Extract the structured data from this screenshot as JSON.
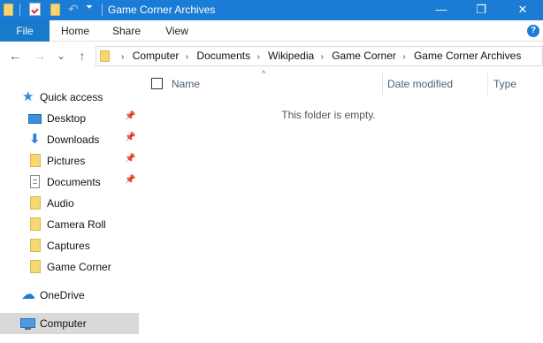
{
  "window": {
    "title": "Game Corner Archives",
    "controls": {
      "minimize": "—",
      "maximize": "❐",
      "close": "✕"
    }
  },
  "ribbon": {
    "tabs": [
      "File",
      "Home",
      "Share",
      "View"
    ],
    "help": "?"
  },
  "navigation": {
    "back": "←",
    "forward": "→",
    "recent": "⌄",
    "up": "↑"
  },
  "address": {
    "crumbs": [
      "Computer",
      "Documents",
      "Wikipedia",
      "Game Corner",
      "Game Corner Archives"
    ],
    "separator": "›"
  },
  "sidebar": {
    "items": [
      {
        "label": "Quick access",
        "icon": "star-icon"
      },
      {
        "label": "Desktop",
        "icon": "desktop-icon",
        "pinned": true
      },
      {
        "label": "Downloads",
        "icon": "download-icon",
        "pinned": true
      },
      {
        "label": "Pictures",
        "icon": "folder-icon",
        "pinned": true
      },
      {
        "label": "Documents",
        "icon": "document-icon",
        "pinned": true
      },
      {
        "label": "Audio",
        "icon": "folder-icon"
      },
      {
        "label": "Camera Roll",
        "icon": "folder-icon"
      },
      {
        "label": "Captures",
        "icon": "folder-icon"
      },
      {
        "label": "Game Corner",
        "icon": "folder-icon"
      },
      {
        "label": "OneDrive",
        "icon": "cloud-icon"
      },
      {
        "label": "Computer",
        "icon": "computer-icon",
        "selected": true
      }
    ],
    "pin_glyph": "📌"
  },
  "content": {
    "columns": [
      "Name",
      "Date modified",
      "Type"
    ],
    "sort_glyph": "^",
    "empty_message": "This folder is empty."
  },
  "colors": {
    "titlebar": "#1a7cd5",
    "file_tab": "#1979ca",
    "selected_item": "#d9d9d9"
  }
}
